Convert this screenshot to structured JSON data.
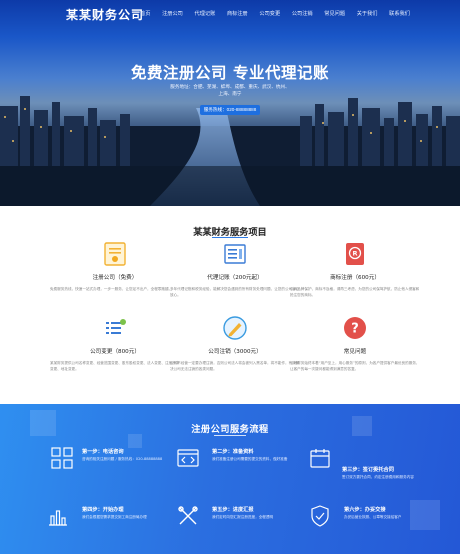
{
  "brand": {
    "logo": "某某财务公司"
  },
  "nav": [
    "首页",
    "注册公司",
    "代理记账",
    "商标注册",
    "公司变更",
    "公司注销",
    "常见问题",
    "关于我们",
    "联系我们"
  ],
  "hero": {
    "title": "免费注册公司 专业代理记账",
    "subtitle": "服务地址：合肥、芜湖、蚌埠、成都、重庆、武汉、杭州、上海、南宁",
    "hotline": "服务热线：020-88888888"
  },
  "services": {
    "title": "某某财务服务项目",
    "items": [
      {
        "name": "注册公司（免费）",
        "desc": "免费服务热线，快速一站式办理，一步一服务，让您足不出户，全程零跑腿。"
      },
      {
        "name": "代理记账（200元起）",
        "desc": "多年代理记账和税务经验，能解决您会遇到的所有财务处理问题，让您的公司省心放心。"
      },
      {
        "name": "商标注册（600元）",
        "desc": "公司品牌保护，商标不及格，请再三考虑，为您的公司保驾护航，防止他人侵害和抢注您的商标。"
      },
      {
        "name": "公司变更（800元）",
        "desc": "某某财务提供公司名称变更、经营范围变更、股东股权变更、法人变更、注册资本变更、地址变更。"
      },
      {
        "name": "公司注销（3000元）",
        "desc": "公司不经营一定要办理注销，否则公司法人将会被列入黑名单，将不能作，有效解决公司无法注销的各类问题。"
      },
      {
        "name": "常见问题",
        "desc": "公司财务始终本着“用户至上，用心服务”的原则，为各户提供客户最优良的服务，让客户的每一次疑问都能得到满意的答复。"
      }
    ]
  },
  "process": {
    "title": "注册公司服务流程",
    "steps": [
      {
        "title": "第一步：电话咨询",
        "desc": "咨询的相关注册问题 / 服务热线：020-88888888"
      },
      {
        "title": "第二步：准备资料",
        "desc": "我们准备注册公司需要的提交的资料，做好准备"
      },
      {
        "title": "第三步：签订委托合同",
        "desc": "签订双方委托合同，约定注册费用和服务内容"
      },
      {
        "title": "第四步：开始办理",
        "desc": "我们会根据您需求提交到工商注册局办理"
      },
      {
        "title": "第五步：进度汇报",
        "desc": "我们定时向您汇报注册进度，全程透明"
      },
      {
        "title": "第六步：办妥交接",
        "desc": "办妥后营业执照、公章等交接给客户"
      }
    ]
  }
}
